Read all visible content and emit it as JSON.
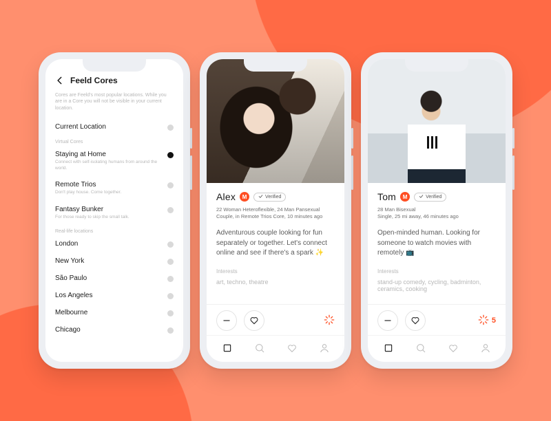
{
  "colors": {
    "accent": "#ff4e22"
  },
  "cores": {
    "header_title": "Feeld Cores",
    "description": "Cores are Feeld's most popular locations. While you are in a Core you will not be visible in your current location.",
    "current_location_label": "Current Location",
    "virtual_section": "Virtual Cores",
    "real_section": "Real-life locations",
    "virtual": [
      {
        "name": "Staying at Home",
        "sub": "Connect with self-isolating humans from around the world.",
        "selected": true
      },
      {
        "name": "Remote Trios",
        "sub": "Don't play house. Come together.",
        "selected": false
      },
      {
        "name": "Fantasy Bunker",
        "sub": "For those ready to skip the small talk.",
        "selected": false
      }
    ],
    "real": [
      {
        "name": "London"
      },
      {
        "name": "New York"
      },
      {
        "name": "São Paulo"
      },
      {
        "name": "Los Angeles"
      },
      {
        "name": "Melbourne"
      },
      {
        "name": "Chicago"
      }
    ]
  },
  "profile_a": {
    "name": "Alex",
    "member_badge": "M",
    "verified_label": "Verified",
    "meta": "22 Woman Heteroflexible, 24 Man Pansexual\nCouple, in Remote Trios Core, 10 minutes ago",
    "bio": "Adventurous couple looking for fun separately or together. Let's connect online and see if there's a spark ✨",
    "interests_label": "Interests",
    "interests": "art, techno, theatre"
  },
  "profile_b": {
    "name": "Tom",
    "member_badge": "M",
    "verified_label": "Verified",
    "meta": "28 Man Bisexual\nSingle, 25 mi away, 46 minutes ago",
    "bio": "Open-minded human. Looking for someone to watch movies with remotely 📺",
    "interests_label": "Interests",
    "interests": "stand-up comedy, cycling, badminton, ceramics, cooking",
    "spark_count": "5"
  }
}
